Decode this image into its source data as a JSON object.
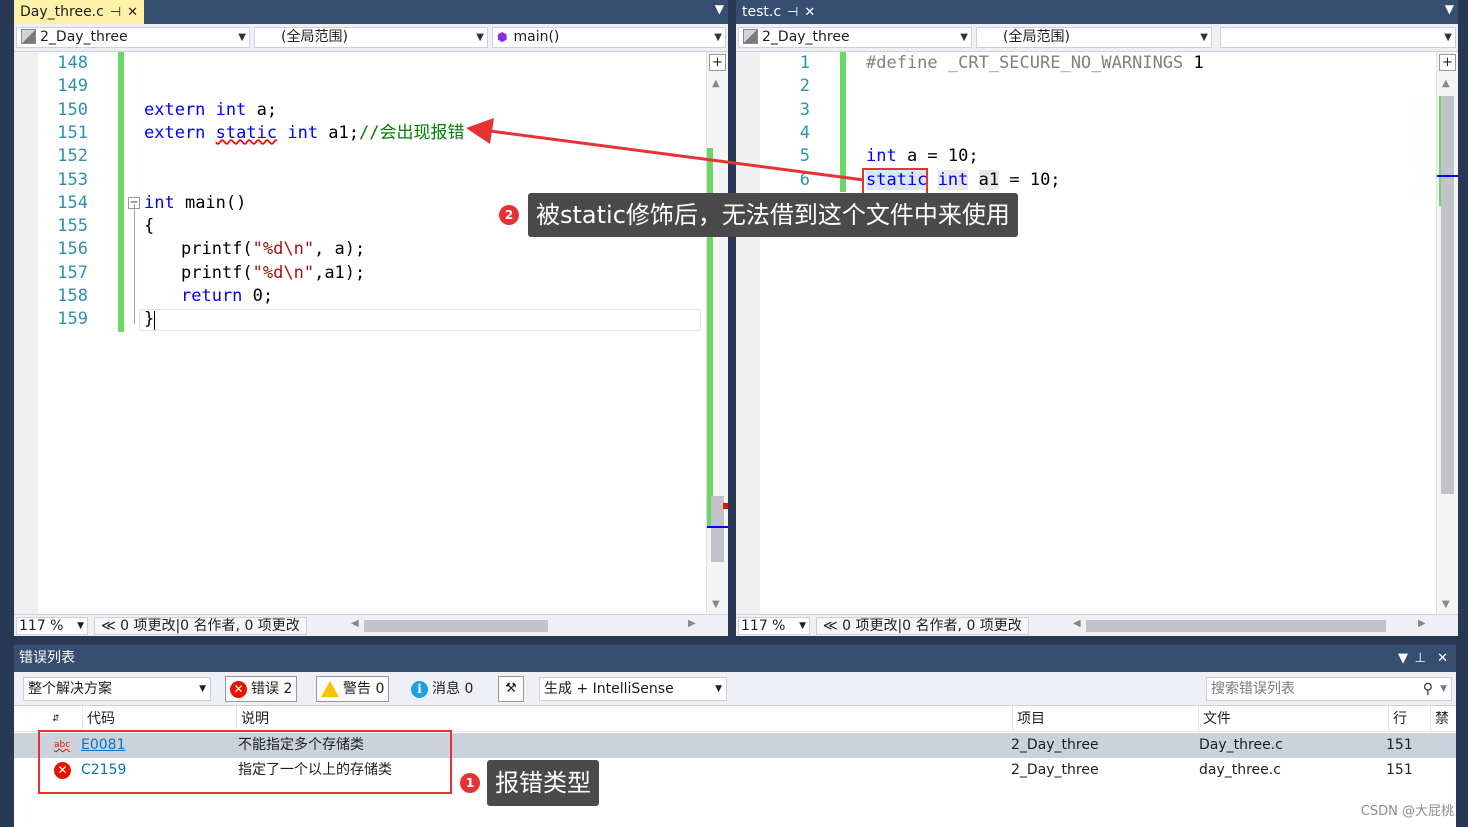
{
  "left_pane": {
    "tab_title": "Day_three.c",
    "tab_pin": "⊣",
    "tab_close": "✕",
    "project_combo": "2_Day_three",
    "scope_combo": "(全局范围)",
    "member_combo": "main()",
    "lines": [
      {
        "num": "148",
        "code": ""
      },
      {
        "num": "149",
        "code": ""
      },
      {
        "num": "150",
        "code": ""
      },
      {
        "num": "151",
        "code": ""
      },
      {
        "num": "152",
        "code": ""
      },
      {
        "num": "153",
        "code": ""
      },
      {
        "num": "154",
        "code": ""
      },
      {
        "num": "155",
        "code": "{"
      },
      {
        "num": "156",
        "code": ""
      },
      {
        "num": "157",
        "code": ""
      },
      {
        "num": "158",
        "code": ""
      },
      {
        "num": "159",
        "code": "}"
      }
    ],
    "code": {
      "l150_kw": "extern int",
      "l150_rest": " a;",
      "l151_kw1": "extern",
      "l151_static": "static",
      "l151_kw2": "int",
      "l151_rest": " a1;",
      "l151_comment": "//会出现报错",
      "l154_fold": "−",
      "l154_kw": "int",
      "l154_rest": " main()",
      "l156_fn": "printf(",
      "l156_str": "\"%d\\n\"",
      "l156_rest": ", a);",
      "l157_fn": "printf(",
      "l157_str": "\"%d\\n\"",
      "l157_rest": ",a1);",
      "l158_kw": "return",
      "l158_rest": " 0;"
    },
    "zoom": "117 %",
    "changes": "0 项更改|0 名作者, 0 项更改"
  },
  "right_pane": {
    "tab_title": "test.c",
    "tab_pin": "⊣",
    "tab_close": "✕",
    "project_combo": "2_Day_three",
    "scope_combo": "(全局范围)",
    "member_combo": "",
    "lines": [
      {
        "num": "1"
      },
      {
        "num": "2"
      },
      {
        "num": "3"
      },
      {
        "num": "4"
      },
      {
        "num": "5"
      },
      {
        "num": "6"
      }
    ],
    "code": {
      "l1_pp": "#define _CRT_SECURE_NO_WARNINGS",
      "l1_val": " 1",
      "l5_kw": "int",
      "l5_rest": " a = 10;",
      "l6_static": "static",
      "l6_int": "int",
      "l6_a1": "a1",
      "l6_rest": " = 10;"
    },
    "zoom": "117 %",
    "changes": "0 项更改|0 名作者, 0 项更改"
  },
  "error_list": {
    "title": "错误列表",
    "scope": "整个解决方案",
    "errors_label": "错误 2",
    "warnings_label": "警告 0",
    "messages_label": "消息 0",
    "source": "生成 + IntelliSense",
    "search_placeholder": "搜索错误列表",
    "columns": {
      "code": "代码",
      "desc": "说明",
      "project": "项目",
      "file": "文件",
      "line": "行",
      "suppress": "禁止"
    },
    "rows": [
      {
        "icon": "abc",
        "code": "E0081",
        "desc": "不能指定多个存储类",
        "project": "2_Day_three",
        "file": "Day_three.c",
        "line": "151"
      },
      {
        "icon": "✕",
        "code": "C2159",
        "desc": "指定了一个以上的存储类",
        "project": "2_Day_three",
        "file": "day_three.c",
        "line": "151"
      }
    ]
  },
  "annotations": {
    "badge1": "1",
    "callout1": "报错类型",
    "badge2": "2",
    "callout2": "被static修饰后，无法借到这个文件中来使用",
    "arrow_color": "#e53333"
  },
  "watermark": "CSDN @大屁桃",
  "colors": {
    "chrome": "#293955",
    "active_tab": "#fff1a8",
    "keyword": "#0000ff",
    "comment": "#008000",
    "string": "#a31515",
    "line_number": "#2b91af",
    "error": "#e51400"
  }
}
